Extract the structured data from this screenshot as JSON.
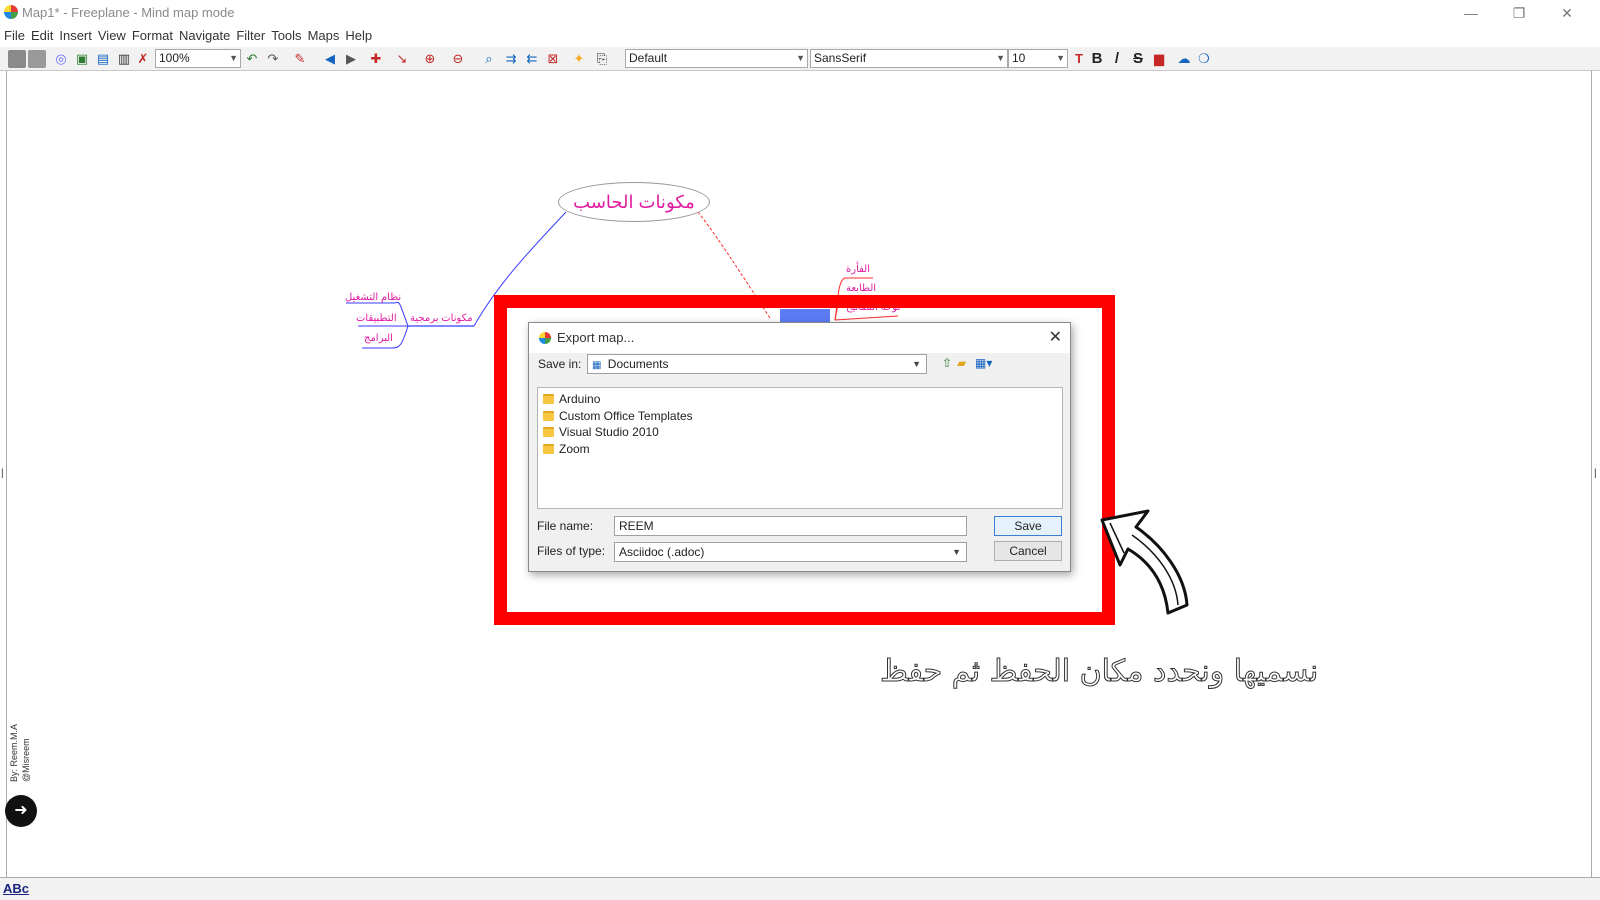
{
  "window": {
    "title": "Map1* - Freeplane - Mind map mode",
    "minimize": "—",
    "maximize": "❐",
    "close": "✕"
  },
  "menu": [
    "File",
    "Edit",
    "Insert",
    "View",
    "Format",
    "Navigate",
    "Filter",
    "Tools",
    "Maps",
    "Help"
  ],
  "toolbar": {
    "zoom": "100%",
    "style": "Default",
    "font": "SansSerif",
    "font_size": "10",
    "bold": "B",
    "italic": "/",
    "strike": "S"
  },
  "mindmap": {
    "root": "مكونات الحاسب",
    "left_branch": "مكونات برمجية",
    "left_children": [
      "نظام التشغيل",
      "التطبيقات",
      "البرامج"
    ],
    "right_children": [
      "الفأرة",
      "الطابعة",
      "لوحة المفاتيح"
    ],
    "colors": {
      "left_edge": "#3b3bff",
      "right_edge": "#ff2b2b",
      "node_text": "#e01ba0"
    }
  },
  "dialog": {
    "title": "Export map...",
    "save_in_label": "Save in:",
    "save_in_value": "Documents",
    "files": [
      "Arduino",
      "Custom Office Templates",
      "Visual Studio 2010",
      "Zoom"
    ],
    "file_name_label": "File name:",
    "file_name_value": "REEM",
    "file_type_label": "Files of type:",
    "file_type_value": "Asciidoc (.adoc)",
    "save_button": "Save",
    "cancel_button": "Cancel"
  },
  "annotation": {
    "text": "نسميها ونحدد مكان الحفظ ثم حفظ",
    "frame_color": "#fe0000"
  },
  "watermark": {
    "line1": "By: Reem.M.A",
    "line2": "@Misreem"
  },
  "status": {
    "spell": "ABc"
  }
}
